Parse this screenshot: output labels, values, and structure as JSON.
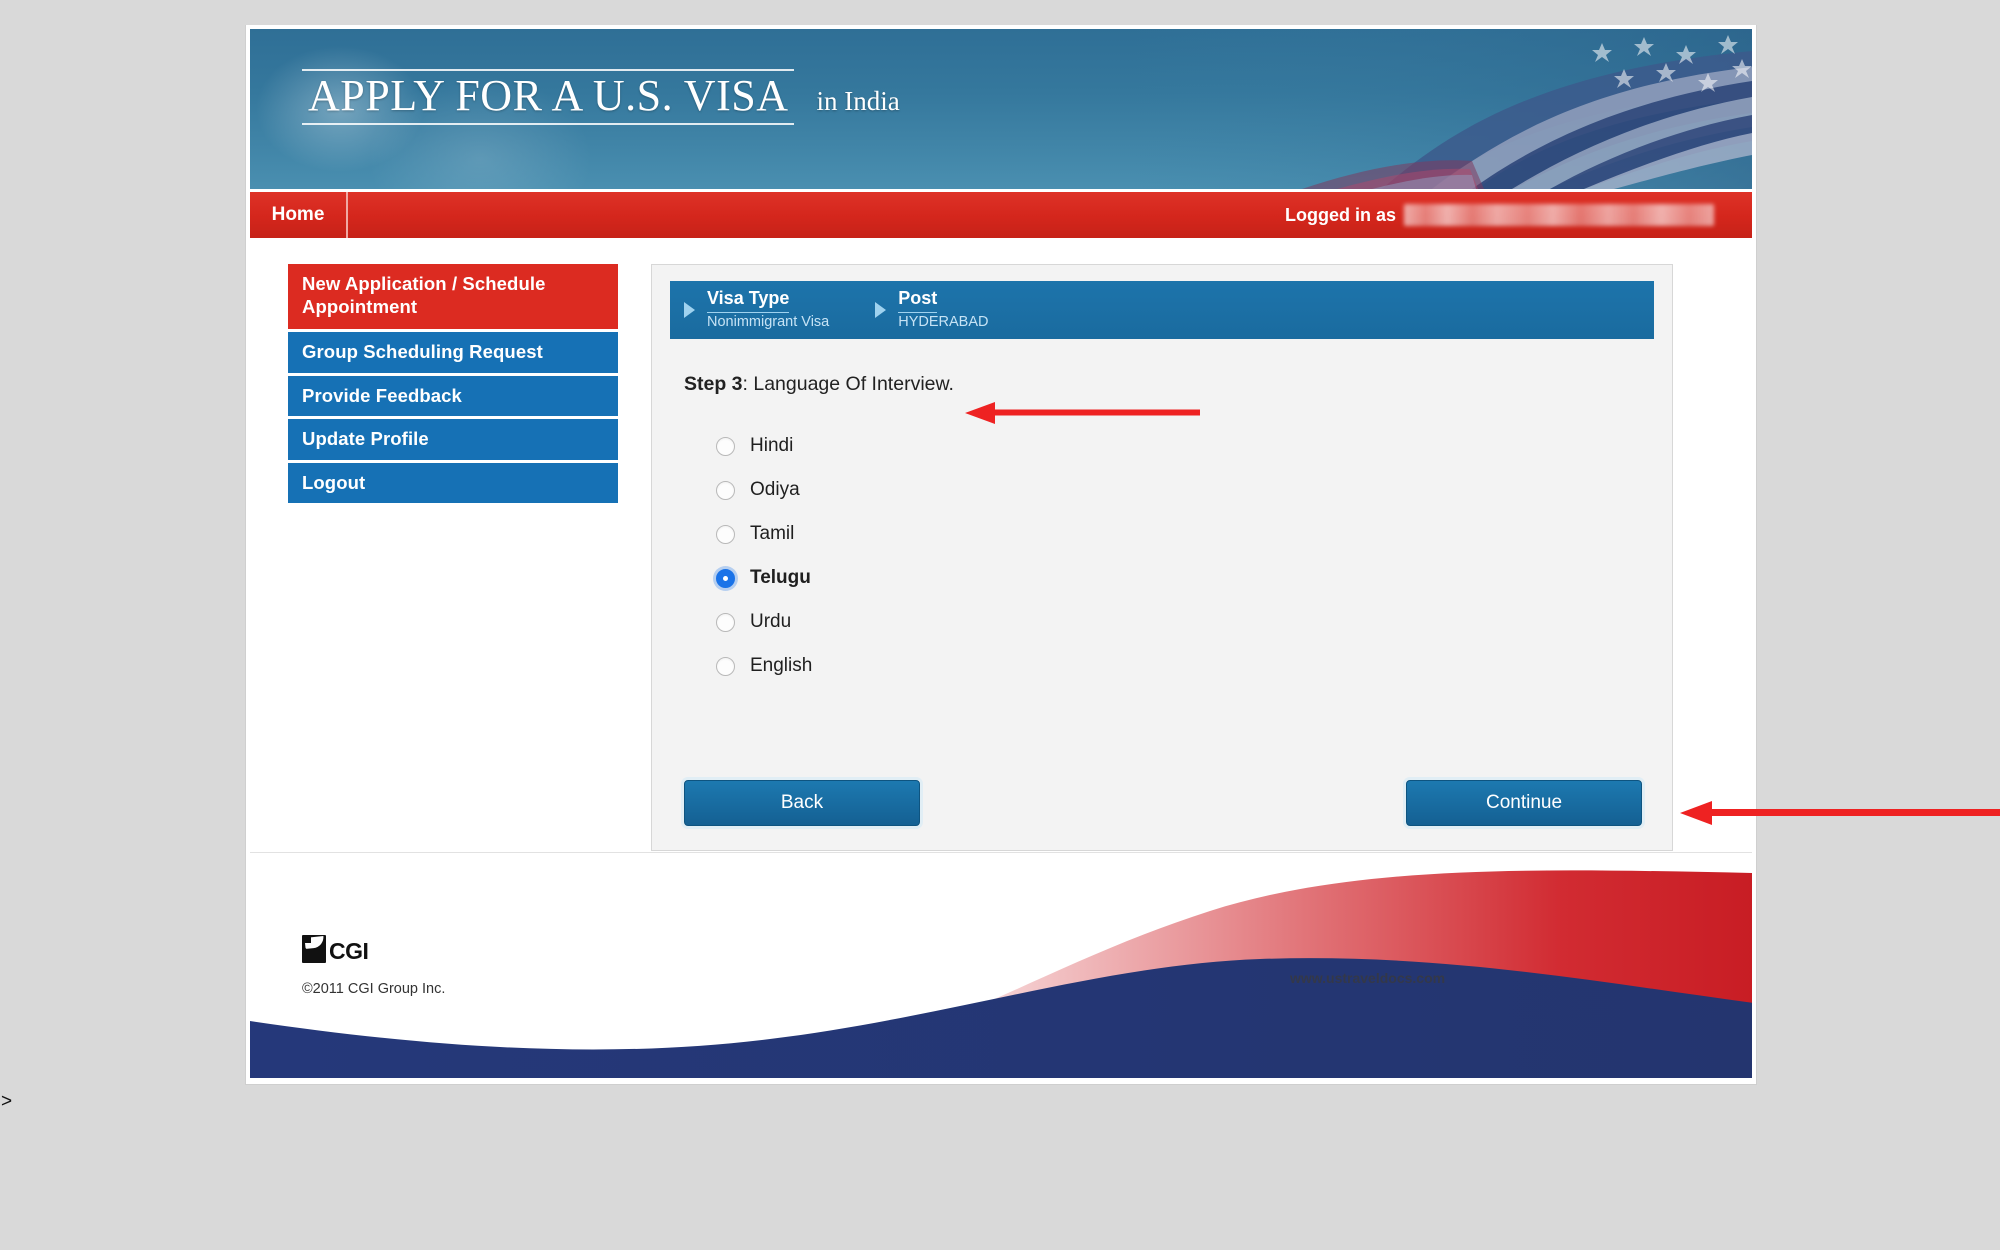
{
  "banner": {
    "title": "APPLY FOR A U.S. VISA",
    "subtitle": "in India",
    "flag_icon": "us-flag-image"
  },
  "navbar": {
    "home_label": "Home",
    "logged_in_label": "Logged in as",
    "logged_in_user": ""
  },
  "sidebar": {
    "items": [
      {
        "label": "New Application / Schedule Appointment",
        "state": "active"
      },
      {
        "label": "Group Scheduling Request",
        "state": "default"
      },
      {
        "label": "Provide Feedback",
        "state": "default"
      },
      {
        "label": "Update Profile",
        "state": "default"
      },
      {
        "label": "Logout",
        "state": "default"
      }
    ]
  },
  "breadcrumb": {
    "items": [
      {
        "title": "Visa Type",
        "value": "Nonimmigrant Visa"
      },
      {
        "title": "Post",
        "value": "HYDERABAD"
      }
    ]
  },
  "step": {
    "number_label": "Step 3",
    "title": ": Language Of Interview."
  },
  "languages": {
    "options": [
      {
        "label": "Hindi",
        "selected": false
      },
      {
        "label": "Odiya",
        "selected": false
      },
      {
        "label": "Tamil",
        "selected": false
      },
      {
        "label": "Telugu",
        "selected": true
      },
      {
        "label": "Urdu",
        "selected": false
      },
      {
        "label": "English",
        "selected": false
      }
    ],
    "selected_value": "Telugu"
  },
  "buttons": {
    "back_label": "Back",
    "continue_label": "Continue"
  },
  "footer": {
    "logo_text": "CGI",
    "copyright": "©2011 CGI Group Inc.",
    "url": "www.ustraveldocs.com"
  },
  "annotations": {
    "arrow_step_color": "#ee2222",
    "arrow_continue_color": "#ee2222"
  },
  "artifacts": {
    "edge_caret": ">"
  },
  "colors": {
    "nav_red": "#d4261c",
    "sidebar_blue": "#1671b5",
    "sidebar_active_red": "#dc2b21",
    "crumb_blue": "#1a6b9f",
    "button_blue": "#176ea4",
    "radio_selected_blue": "#1a73e8",
    "footer_navy": "#25387a",
    "footer_red": "#cf2027"
  }
}
